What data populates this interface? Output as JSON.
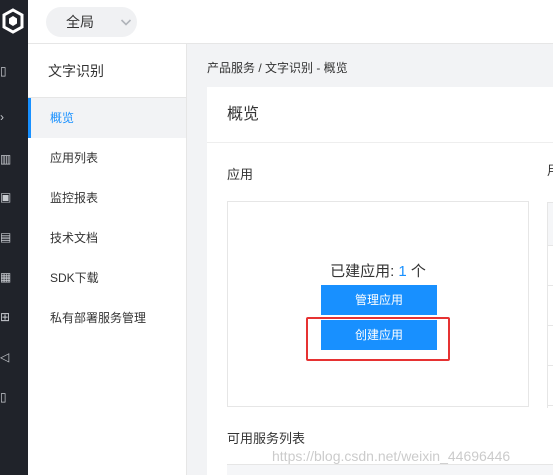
{
  "topbar": {
    "region": "全局"
  },
  "subnav": {
    "title": "文字识别",
    "items": [
      {
        "label": "概览"
      },
      {
        "label": "应用列表"
      },
      {
        "label": "监控报表"
      },
      {
        "label": "技术文档"
      },
      {
        "label": "SDK下载"
      },
      {
        "label": "私有部署服务管理"
      }
    ]
  },
  "breadcrumb": "产品服务 / 文字识别 - 概览",
  "card": {
    "title": "概览",
    "apps_section": "应用",
    "apps_count_prefix": "已建应用: ",
    "apps_count": "1",
    "apps_count_suffix": " 个",
    "manage_button": "管理应用",
    "create_button": "创建应用",
    "services_section": "可用服务列表",
    "right_section_partial": "用"
  },
  "watermark": "https://blog.csdn.net/weixin_44696446",
  "colors": {
    "accent": "#1890ff",
    "highlight": "#e63232",
    "rail": "#20232a"
  }
}
